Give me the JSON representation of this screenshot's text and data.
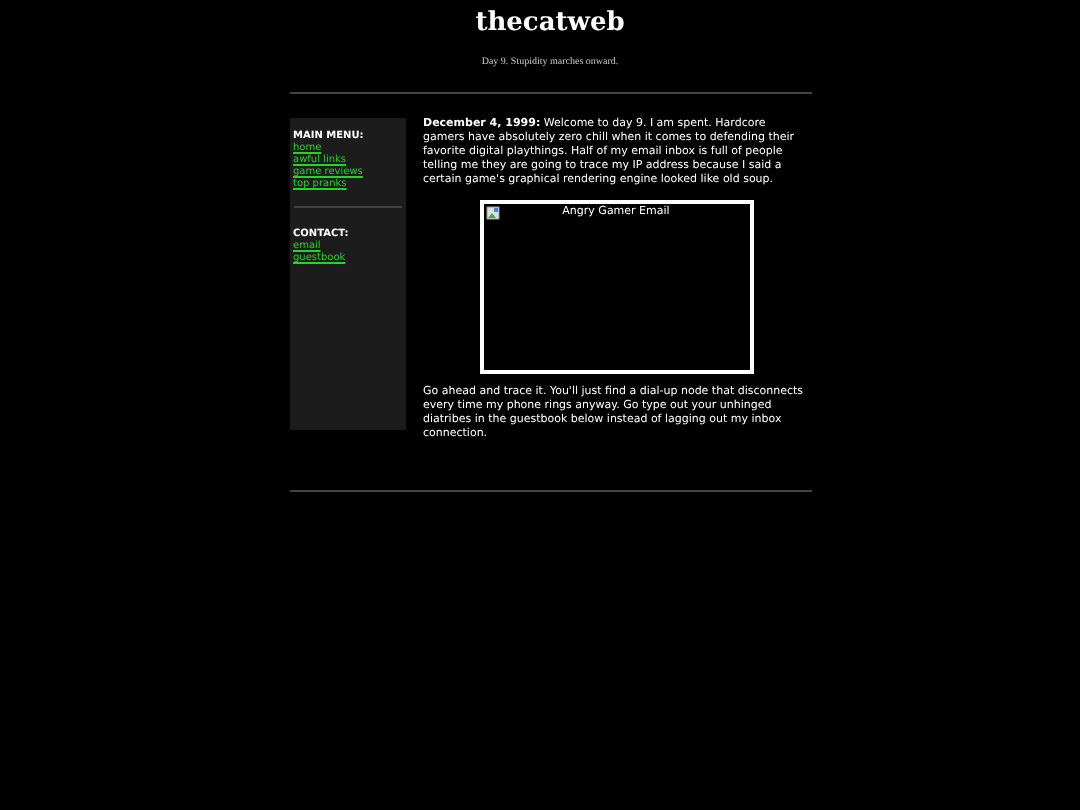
{
  "header": {
    "title": "thecatweb",
    "tagline": "Day 9. Stupidity marches onward."
  },
  "sidebar": {
    "sections": [
      {
        "heading": "MAIN MENU:",
        "links": [
          "home",
          "awful links",
          "game reviews",
          "top pranks"
        ]
      },
      {
        "heading": "CONTACT:",
        "links": [
          "email",
          "guestbook"
        ]
      }
    ]
  },
  "post": {
    "intro": "**December 4, 1999:** Welcome to day 9. I am spent. Hardcore gamers have absolutely zero chill when it comes to defending their favorite digital playthings. Half of my email inbox is full of people telling me they are going to trace my IP address because I said a certain game's graphical rendering engine looked like old soup.",
    "image": {
      "alt": "Angry Gamer Email"
    },
    "outro": "Go ahead and trace it. You'll just find a dial-up node that disconnects every time my phone rings anyway. Go type out your unhinged diatribes in the guestbook below instead of lagging out my inbox connection."
  }
}
